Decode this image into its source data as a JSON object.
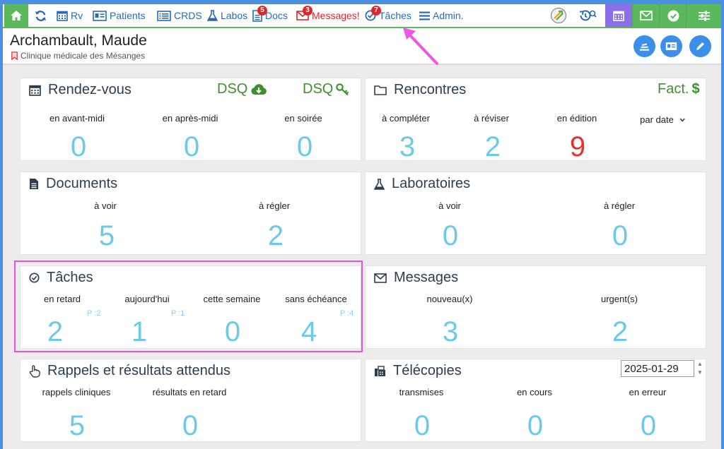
{
  "nav": {
    "rv": "Rv",
    "patients": "Patients",
    "crds": "CRDS",
    "labos": "Labos",
    "docs": "Docs",
    "docs_badge": "5",
    "messages": "Messages!",
    "messages_badge": "3",
    "taches": "Tâches",
    "taches_badge": "7",
    "admin": "Admin."
  },
  "patient": {
    "name": "Archambault, Maude",
    "clinic": "Clinique médicale des Mésanges"
  },
  "rdv": {
    "title": "Rendez-vous",
    "dsq1": "DSQ",
    "dsq2": "DSQ",
    "cols": [
      {
        "label": "en avant-midi",
        "value": "0"
      },
      {
        "label": "en après-midi",
        "value": "0"
      },
      {
        "label": "en soirée",
        "value": "0"
      }
    ]
  },
  "rencontres": {
    "title": "Rencontres",
    "fact": "Fact.",
    "fact_sign": "$",
    "cols": [
      {
        "label": "à compléter",
        "value": "3"
      },
      {
        "label": "à réviser",
        "value": "2"
      },
      {
        "label": "en édition",
        "value": "9"
      }
    ],
    "sort_select": "par date"
  },
  "documents": {
    "title": "Documents",
    "cols": [
      {
        "label": "à voir",
        "value": "5"
      },
      {
        "label": "à régler",
        "value": "2"
      }
    ]
  },
  "labos": {
    "title": "Laboratoires",
    "cols": [
      {
        "label": "à voir",
        "value": "0"
      },
      {
        "label": "à régler",
        "value": "0"
      }
    ]
  },
  "taches": {
    "title": "Tâches",
    "cols": [
      {
        "label": "en retard",
        "value": "2",
        "p": "P :2"
      },
      {
        "label": "aujourd'hui",
        "value": "1",
        "p": "P :1"
      },
      {
        "label": "cette semaine",
        "value": "0"
      },
      {
        "label": "sans échéance",
        "value": "4",
        "p": "P :4"
      }
    ]
  },
  "messages": {
    "title": "Messages",
    "cols": [
      {
        "label": "nouveau(x)",
        "value": "3"
      },
      {
        "label": "urgent(s)",
        "value": "2"
      }
    ]
  },
  "rappels": {
    "title": "Rappels et résultats attendus",
    "cols": [
      {
        "label": "rappels cliniques",
        "value": "5"
      },
      {
        "label": "résultats en retard",
        "value": "0"
      }
    ]
  },
  "telecopies": {
    "title": "Télécopies",
    "date": "2025-01-29",
    "cols": [
      {
        "label": "transmises",
        "value": "0"
      },
      {
        "label": "en cours",
        "value": "0"
      },
      {
        "label": "en erreur",
        "value": "0"
      }
    ]
  },
  "colors": {
    "accent_green": "#5cb85c",
    "nav_blue": "#2a6bb0",
    "value_cyan": "#6cc9e8",
    "alert_red": "#e5332a",
    "highlight_magenta": "#e94fe0",
    "annotation_arrow": "#ee55e8"
  }
}
